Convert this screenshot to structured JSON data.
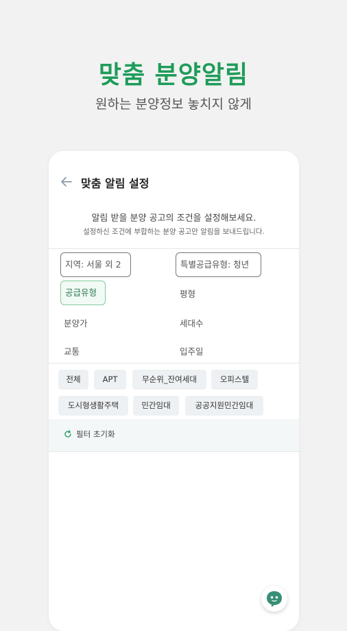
{
  "hero": {
    "title": "맞춤 분양알림",
    "subtitle": "원하는 분양정보 놓치지 않게"
  },
  "header": {
    "title": "맞춤 알림 설정",
    "back_icon": "back-arrow-icon"
  },
  "description": {
    "line1": "알림 받을 분양 공고의 조건을 설정해보세요.",
    "line2": "설정하신 조건에 부합하는 분양 공고만 알림을 보내드립니다."
  },
  "filters": {
    "region": "지역: 서울 외 2",
    "special_supply": "특별공급유형: 청년",
    "supply_type": "공급유형",
    "area": "평형",
    "price": "분양가",
    "households": "세대수",
    "transport": "교통",
    "move_in": "입주일"
  },
  "chips": [
    "전체",
    "APT",
    "무순위_잔여세대",
    "오피스텔",
    "도시형생활주택",
    "민간임대",
    "공공지원민간임대"
  ],
  "reset": {
    "label": "필터 초기화",
    "icon": "refresh-icon"
  },
  "fab": {
    "icon": "chat-bot-icon"
  },
  "colors": {
    "brand": "#1e9c5a",
    "selected_border": "#85c9a1",
    "chip_bg": "#eef1f3"
  }
}
